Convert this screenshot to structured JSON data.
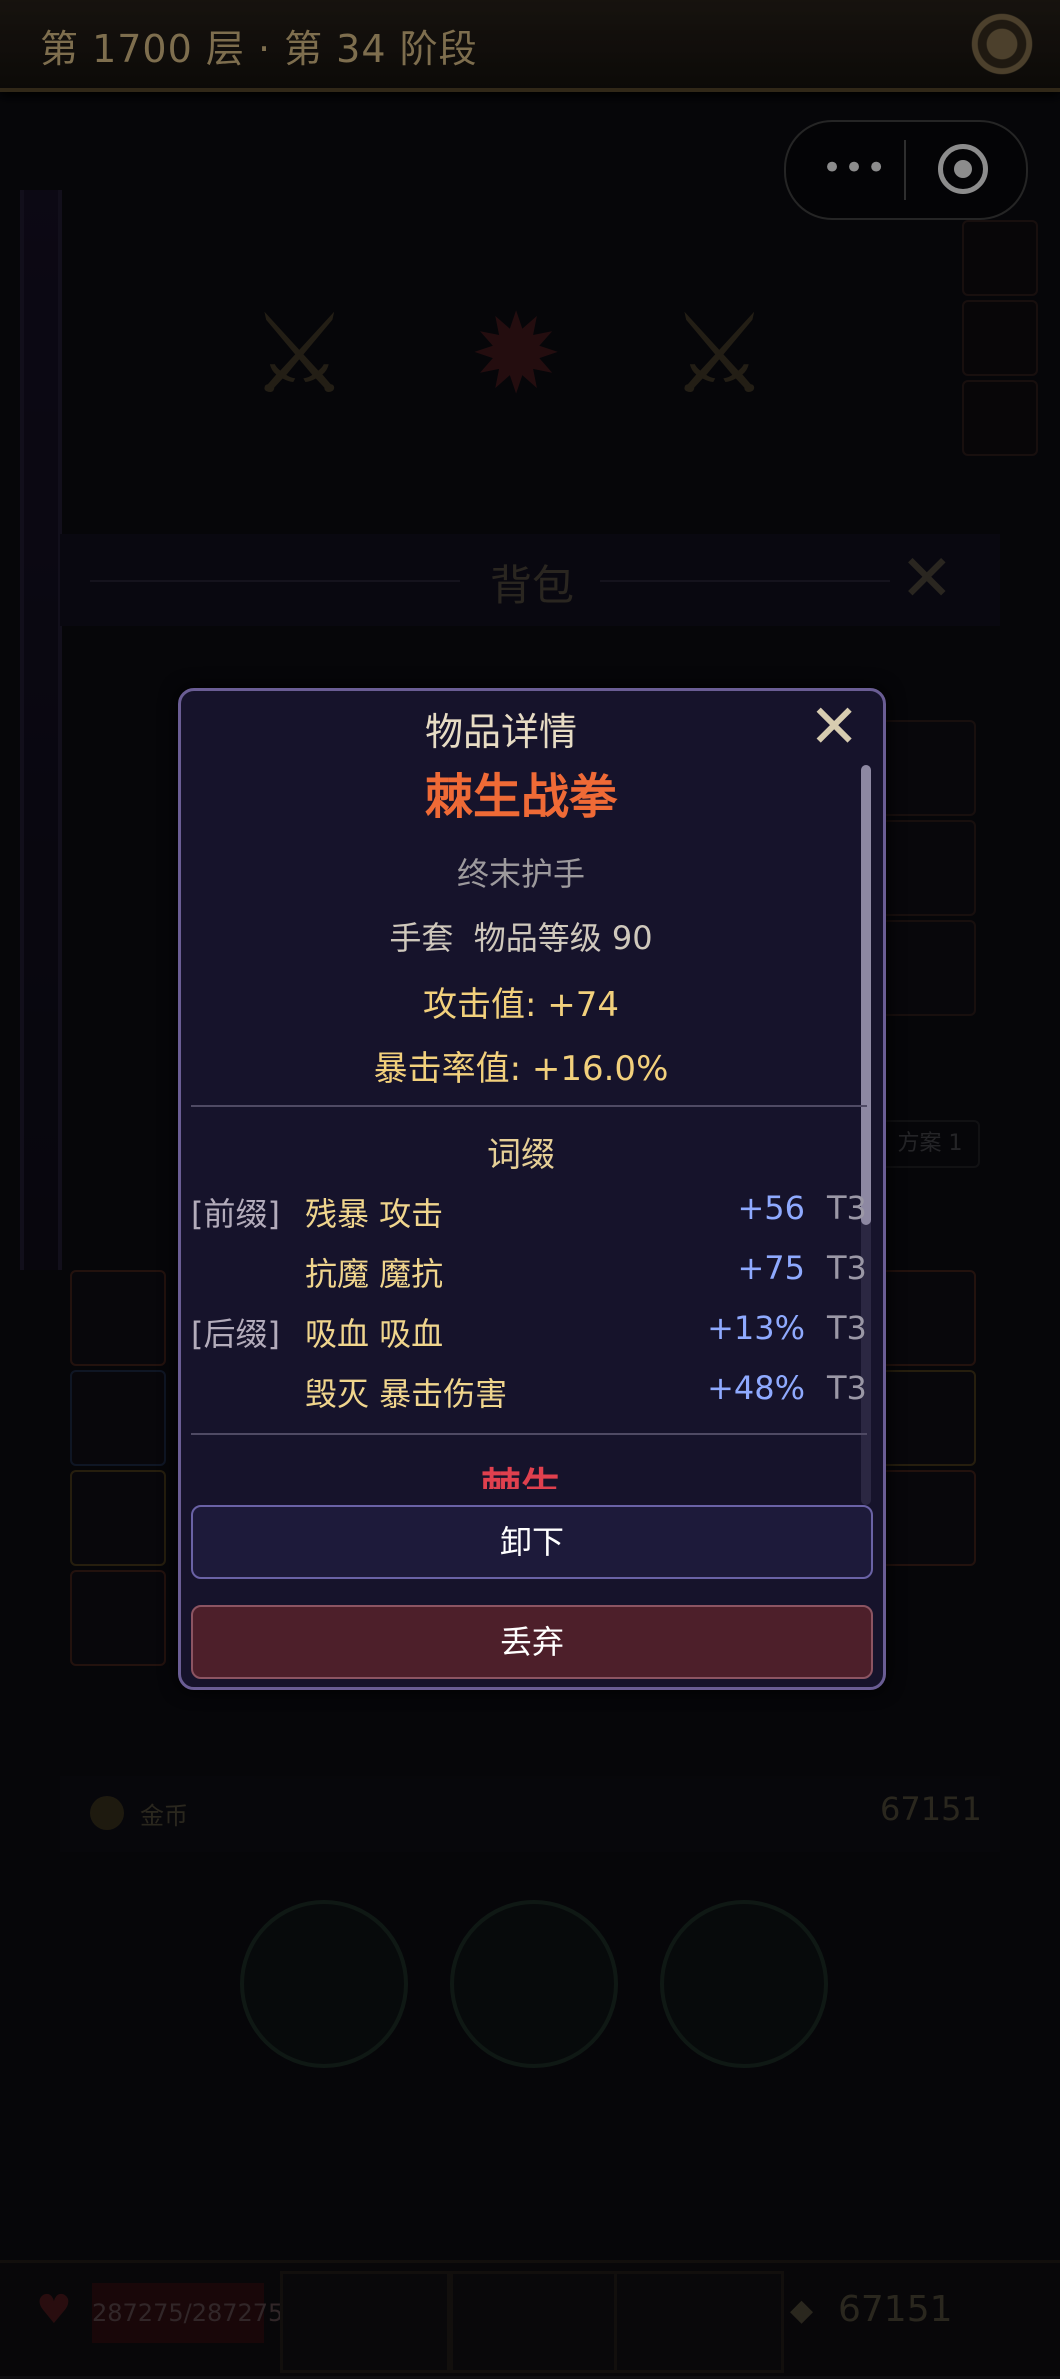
{
  "header": {
    "title": "第 1700 层 · 第 34 阶段",
    "settings_icon": "gear-icon"
  },
  "mini_program_capsule": {
    "more_icon": "•••",
    "close_icon": "target-icon"
  },
  "background": {
    "bag_title": "背包",
    "right_label": "方案 1",
    "gold_label": "金币",
    "gold_value": "67151",
    "hp": "287275/287275",
    "bottom_gold": "67151"
  },
  "modal": {
    "title": "物品详情",
    "item_name": "棘生战拳",
    "base_type": "终末护手",
    "meta_line": "手套  物品等级 90",
    "stats": [
      "攻击值: +74",
      "暴击率值: +16.0%"
    ],
    "affix_header": "词缀",
    "affixes": [
      {
        "tag": "[前缀]",
        "name": "残暴 攻击",
        "value": "+56",
        "tier": "T3"
      },
      {
        "tag": "",
        "name": "抗魔 魔抗",
        "value": "+75",
        "tier": "T3"
      },
      {
        "tag": "[后缀]",
        "name": "吸血 吸血",
        "value": "+13%",
        "tier": "T3"
      },
      {
        "tag": "",
        "name": "毁灭 暴击伤害",
        "value": "+48%",
        "tier": "T3"
      }
    ],
    "set_name_partial": "棘生",
    "buttons": {
      "unequip": "卸下",
      "discard": "丢弃"
    },
    "colors": {
      "item_name": "#ef6a36",
      "stat": "#f2d07c",
      "affix_value": "#8faaff",
      "set": "#e0404e"
    }
  }
}
